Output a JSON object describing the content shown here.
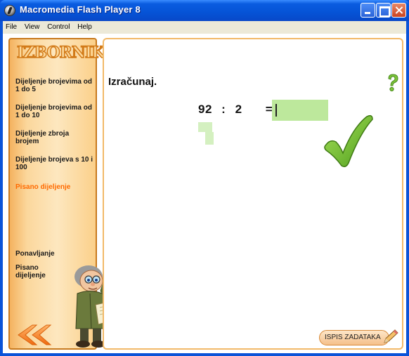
{
  "window": {
    "title": "Macromedia Flash Player 8"
  },
  "menu": [
    "File",
    "View",
    "Control",
    "Help"
  ],
  "sidebar": {
    "logo": "IZBORNIK",
    "items": [
      {
        "label": "Dijeljenje brojevima od 1 do 5",
        "active": false
      },
      {
        "label": "Dijeljenje brojevima od 1 do 10",
        "active": false
      },
      {
        "label": "Dijeljenje zbroja brojem",
        "active": false
      },
      {
        "label": "Dijeljenje brojeva s 10 i 100",
        "active": false
      },
      {
        "label": "Pisano dijeljenje",
        "active": true
      }
    ],
    "bottom_items": [
      {
        "label": "Ponavljanje"
      },
      {
        "label": "Pisano dijeljenje"
      }
    ]
  },
  "main": {
    "heading": "Izračunaj.",
    "expression": {
      "dividend": "92",
      "operator": ":",
      "divisor": "2",
      "equals": "=",
      "answer": ""
    },
    "print_button": "ISPIS ZADATAKA"
  },
  "colors": {
    "accent_orange": "#ff6a00",
    "answer_box": "#bde89c",
    "check_green": "#6fbf2a"
  },
  "icons": [
    "flash-app-icon",
    "help-question-icon",
    "checkmark-icon",
    "back-arrows-icon",
    "pencil-icon",
    "teacher-illustration"
  ]
}
